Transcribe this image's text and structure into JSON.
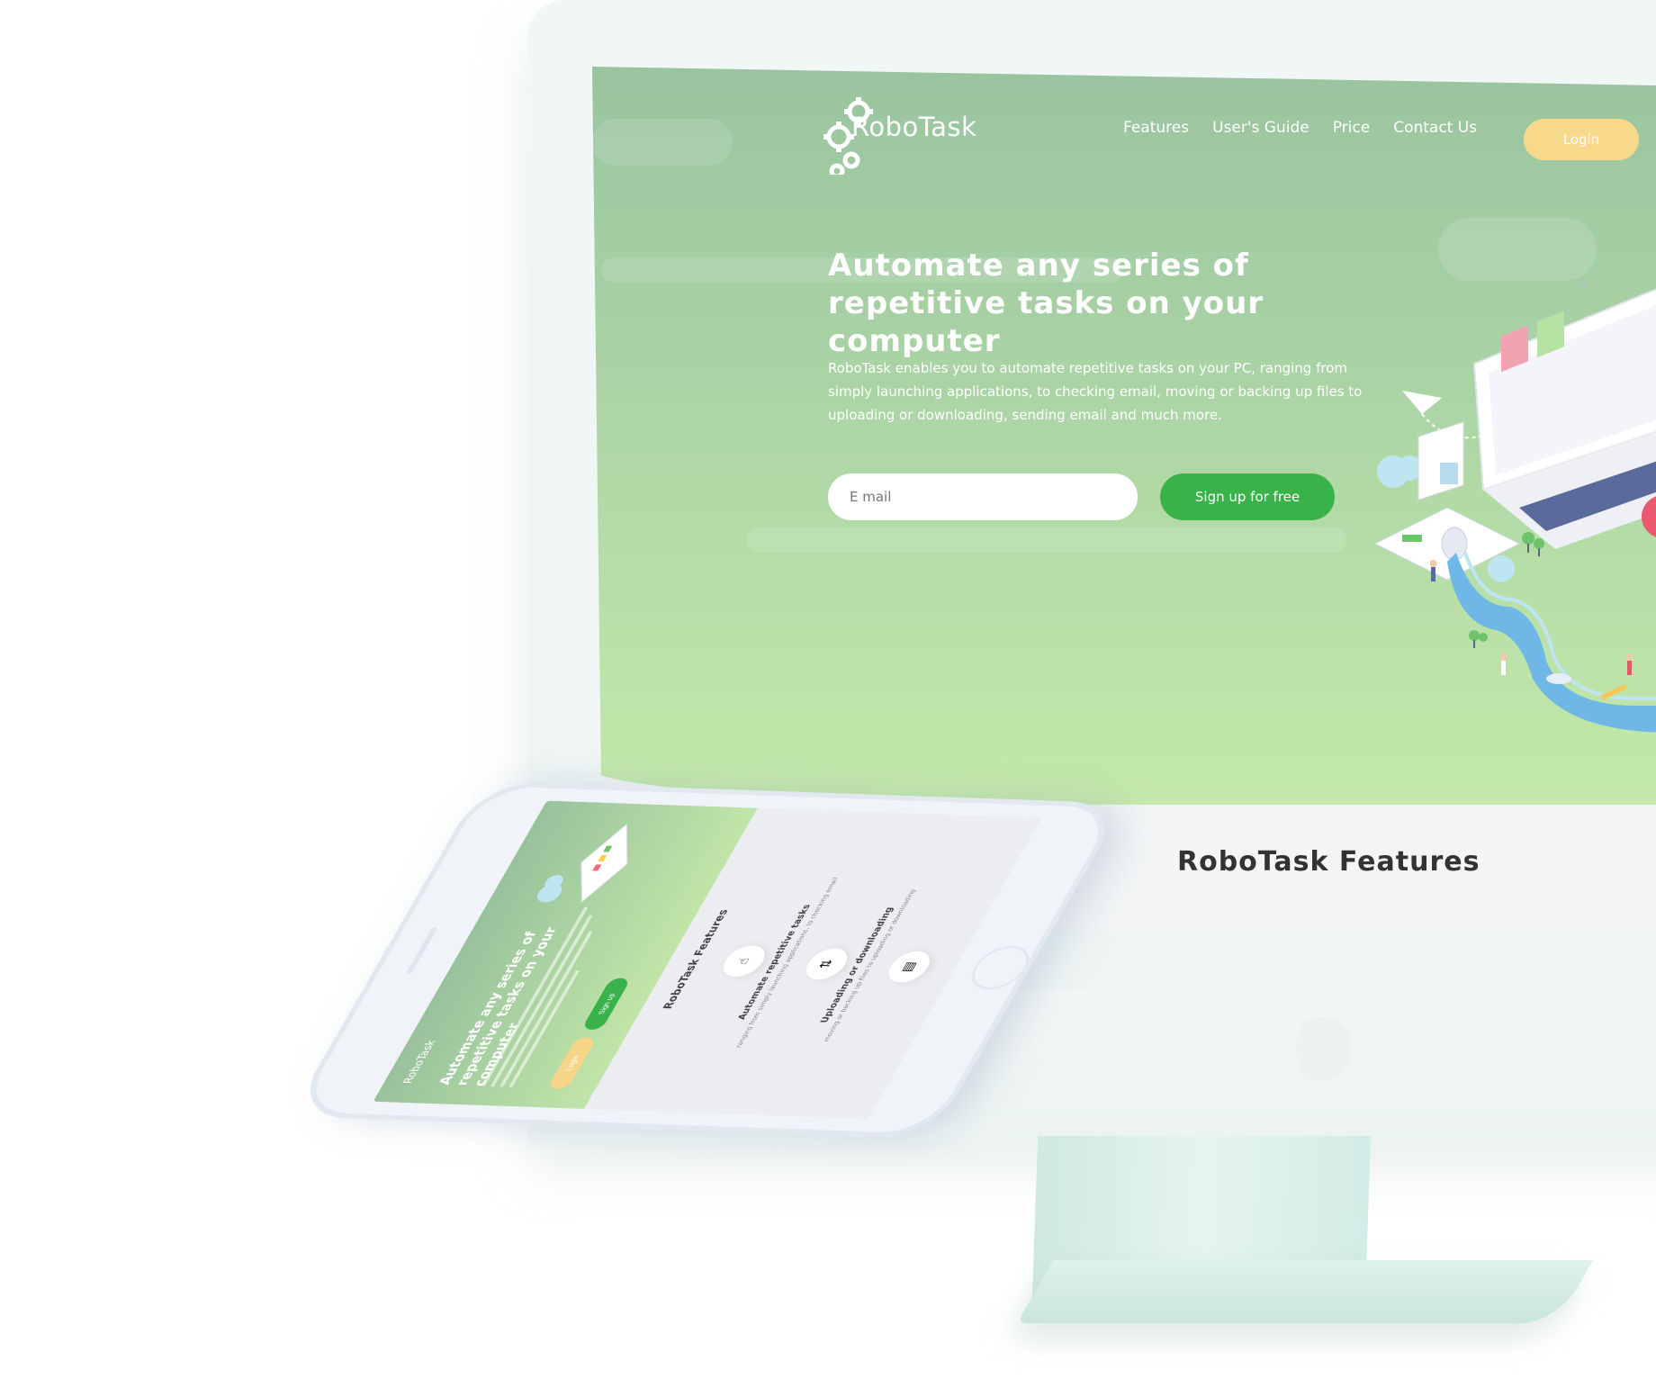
{
  "site": {
    "brand": "RoboTask",
    "nav": [
      "Features",
      "User's Guide",
      "Price",
      "Contact Us"
    ],
    "login_label": "Login",
    "headline": "Automate any series of repetitive tasks on your computer",
    "description": "RoboTask enables you to automate repetitive tasks on your  PC, ranging from simply launching applications, to checking email, moving or backing up files to uploading or downloading, sending email and much more.",
    "email_placeholder": "E mail",
    "signup_label": "Sign up for free",
    "features_title": "RoboTask Features"
  },
  "phone": {
    "brand": "RoboTask",
    "headline": "Automate any series of repetitive tasks on your computer",
    "login_label": "Login",
    "signup_label": "Sign up",
    "features_title": "RoboTask Features",
    "items": [
      {
        "title": "Automate repetitive tasks",
        "text": "ranging from simply launching applications, to checking email"
      },
      {
        "title": "Uploading or downloading",
        "text": "moving or backing up files to uploading or downloading"
      }
    ]
  },
  "colors": {
    "hero_top": "#9ac49f",
    "hero_bottom": "#c4e9aa",
    "accent_green": "#38b249",
    "login_yellow": "#f8d98b"
  }
}
